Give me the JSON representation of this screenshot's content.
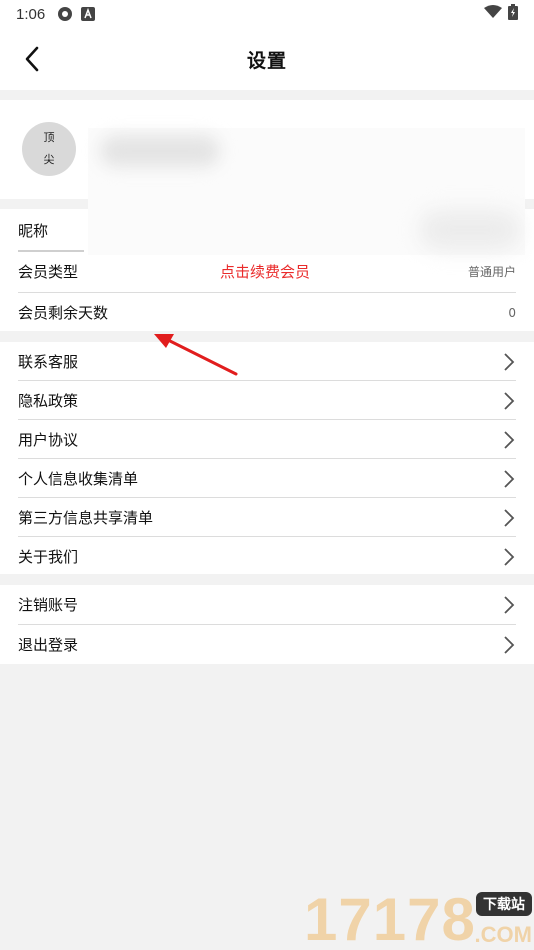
{
  "status_bar": {
    "time": "1:06"
  },
  "header": {
    "title": "设置"
  },
  "profile": {
    "avatar_line1": "顶",
    "avatar_line2": "尖"
  },
  "account": {
    "nickname_label": "昵称",
    "member_type_label": "会员类型",
    "renew_promo": "点击续费会员",
    "member_type_value": "普通用户",
    "days_left_label": "会员剩余天数",
    "days_left_value": "0"
  },
  "info_menu": [
    {
      "label": "联系客服"
    },
    {
      "label": "隐私政策"
    },
    {
      "label": "用户协议"
    },
    {
      "label": "个人信息收集清单"
    },
    {
      "label": "第三方信息共享清单"
    },
    {
      "label": "关于我们"
    }
  ],
  "account_menu": [
    {
      "label": "注销账号"
    },
    {
      "label": "退出登录"
    }
  ],
  "watermark": {
    "number": "17178",
    "badge": "下载站",
    "domain": ".COM"
  },
  "colors": {
    "promo": "#ea2b2b",
    "arrow": "#e11d1d"
  },
  "icons": [
    "back-arrow-icon",
    "chevron-right-icon",
    "wifi-icon",
    "battery-icon"
  ]
}
